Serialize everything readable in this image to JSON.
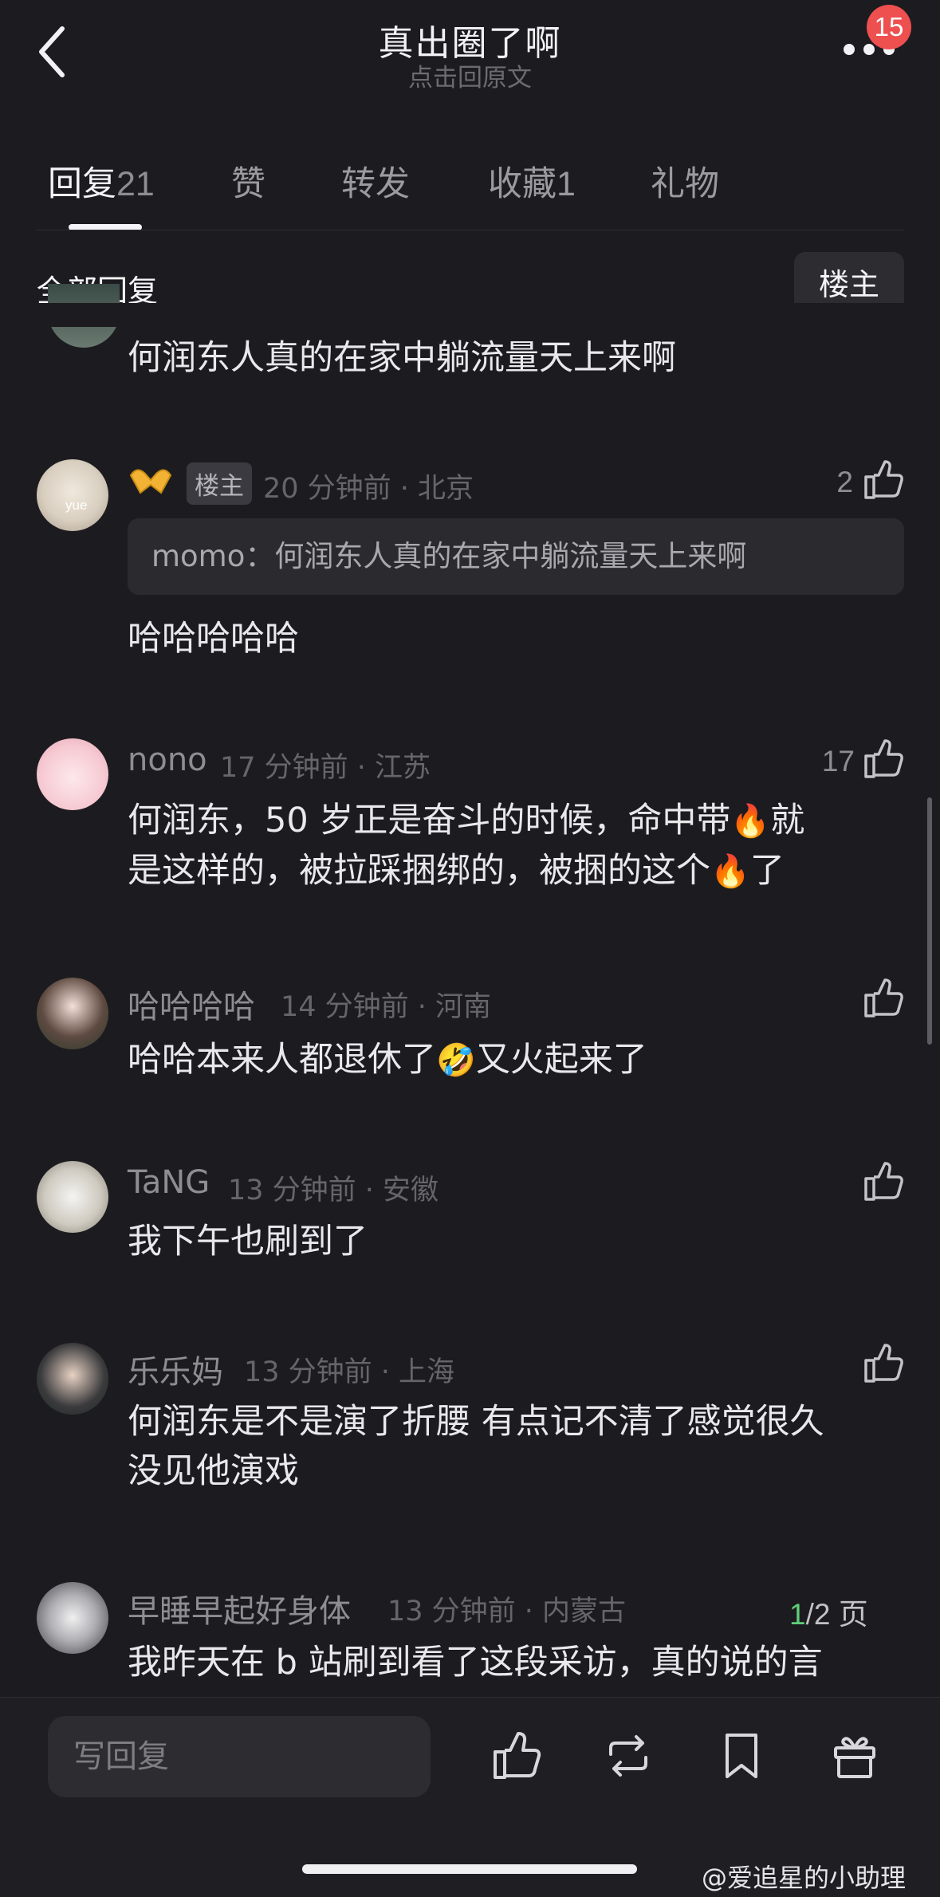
{
  "header": {
    "title": "真出圈了啊",
    "subtitle": "点击回原文",
    "badge_count": "15"
  },
  "tabs": [
    {
      "label": "回复",
      "count": "21",
      "active": true
    },
    {
      "label": "赞",
      "count": ""
    },
    {
      "label": "转发",
      "count": ""
    },
    {
      "label": "收藏",
      "count": "1"
    },
    {
      "label": "礼物",
      "count": ""
    }
  ],
  "section": {
    "title": "全部回复",
    "owner_filter": "楼主"
  },
  "comments": [
    {
      "text": "何润东人真的在家中躺流量天上来啊"
    },
    {
      "avatar_text": "yue",
      "owner_tag": "楼主",
      "meta": "20 分钟前 · 北京",
      "likes": "2",
      "quote": "momo：何润东人真的在家中躺流量天上来啊",
      "text": "哈哈哈哈哈"
    },
    {
      "name": "nono",
      "meta": "17 分钟前 · 江苏",
      "likes": "17",
      "line1a": "何润东，50 岁正是奋斗的时候，命中带",
      "line1b": "就",
      "line2a": "是这样的，被拉踩捆绑的，被捆的这个",
      "line2b": "了"
    },
    {
      "name": "哈哈哈哈",
      "meta": "14 分钟前 · 河南",
      "text_a": "哈哈本来人都退休了",
      "text_b": "又火起来了"
    },
    {
      "name": "TaNG",
      "meta": "13 分钟前 · 安徽",
      "text": "我下午也刷到了"
    },
    {
      "name": "乐乐妈",
      "meta": "13 分钟前 · 上海",
      "line1": "何润东是不是演了折腰 有点记不清了感觉很久",
      "line2": "没见他演戏"
    },
    {
      "name": "早睡早起好身体",
      "meta": "13 分钟前 · 内蒙古",
      "text": "我昨天在 b 站刷到看了这段采访，真的说的言"
    }
  ],
  "page": {
    "current": "1",
    "total": "/2 页"
  },
  "bottom": {
    "reply_placeholder": "写回复"
  },
  "watermark": "@爱追星的小助理",
  "colors": {
    "background": "#1c1c20",
    "badge": "#ee4f4f",
    "page_current": "#5fcf79"
  }
}
